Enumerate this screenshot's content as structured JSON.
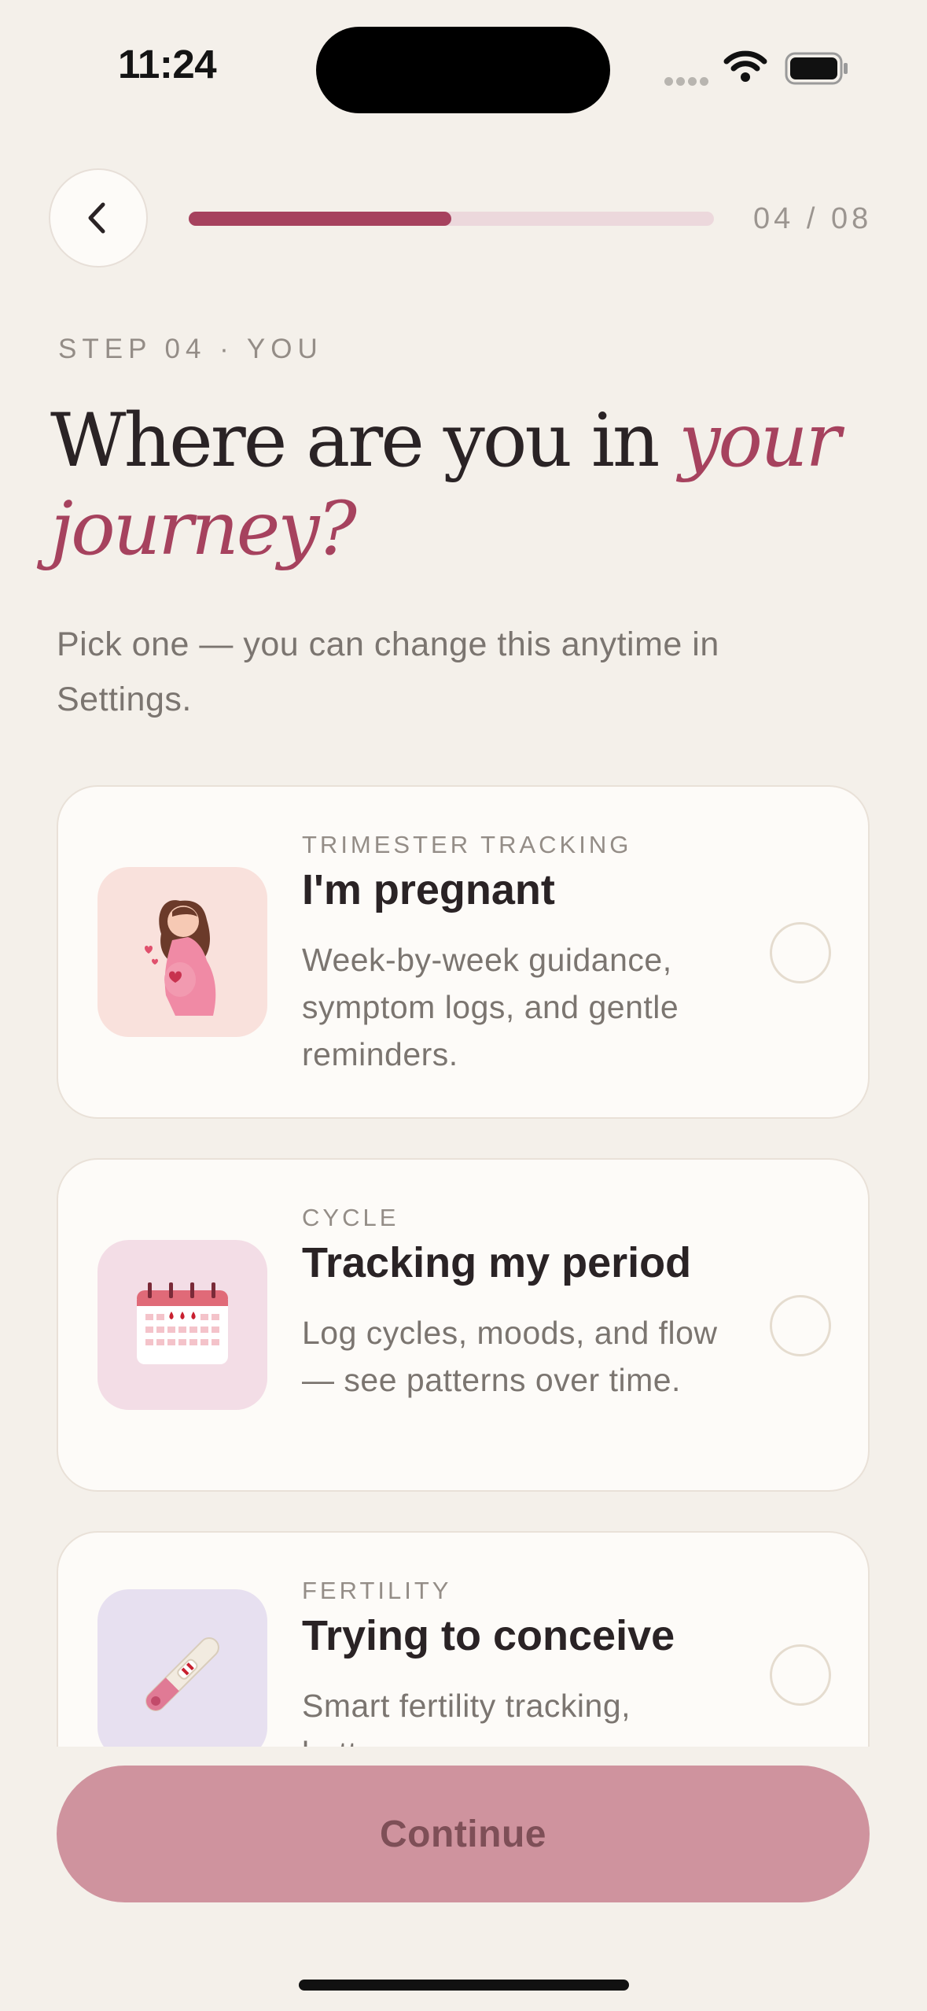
{
  "status_bar": {
    "time": "11:24"
  },
  "progress": {
    "label": "04 / 08",
    "current": 4,
    "total": 8,
    "fraction": 0.5
  },
  "eyebrow": "STEP 04 · YOU",
  "heading": {
    "plain": "Where are you in ",
    "accent": "your journey?"
  },
  "subtitle": "Pick one — you can change this anytime in Settings.",
  "options": [
    {
      "category": "TRIMESTER TRACKING",
      "title": "I'm pregnant",
      "description": "Week-by-week guidance, symptom logs, and gentle reminders.",
      "icon": "pregnant-woman-icon",
      "tint": "#f9e1dc",
      "selected": false
    },
    {
      "category": "CYCLE",
      "title": "Tracking my period",
      "description": "Log cycles, moods, and flow — see patterns over time.",
      "icon": "calendar-icon",
      "tint": "#f3dde6",
      "selected": false
    },
    {
      "category": "FERTILITY",
      "title": "Trying to conceive",
      "description": "Smart fertility tracking, better...",
      "icon": "ovulation-test-icon",
      "tint": "#e7e0f0",
      "selected": false
    }
  ],
  "continue_label": "Continue",
  "colors": {
    "accent": "#a6425e",
    "background": "#f4f0ea",
    "button": "#cf939e"
  }
}
